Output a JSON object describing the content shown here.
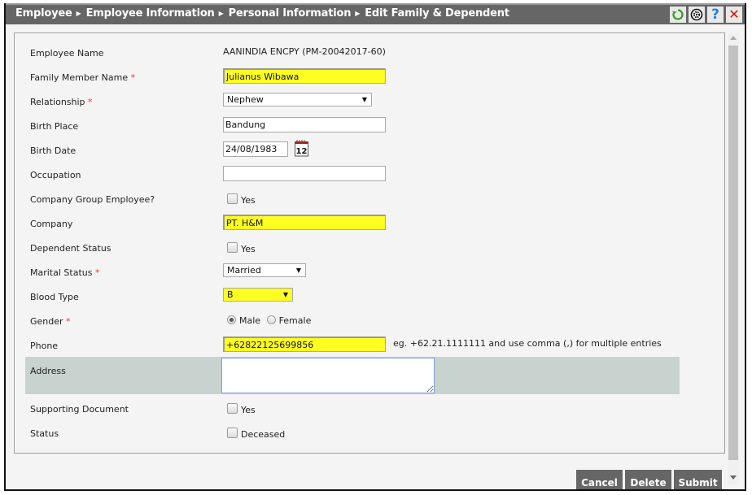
{
  "header": {
    "breadcrumb": [
      "Employee",
      "Employee Information",
      "Personal Information",
      "Edit Family & Dependent"
    ],
    "separator_icon": "triangle-right-icon",
    "icons": [
      "refresh-icon",
      "settings-icon",
      "help-icon",
      "close-icon"
    ],
    "help_glyph": "?",
    "close_glyph": "✕"
  },
  "form": {
    "employee_name": {
      "label": "Employee Name",
      "value": "AANINDIA ENCPY (PM-20042017-60)"
    },
    "family_member_name": {
      "label": "Family Member Name",
      "required": "*",
      "value": "Julianus Wibawa"
    },
    "relationship": {
      "label": "Relationship",
      "required": "*",
      "value": "Nephew"
    },
    "birth_place": {
      "label": "Birth Place",
      "value": "Bandung"
    },
    "birth_date": {
      "label": "Birth Date",
      "value": "24/08/1983",
      "calendar_day": "12"
    },
    "occupation": {
      "label": "Occupation",
      "value": ""
    },
    "company_group_employee": {
      "label": "Company Group Employee?",
      "option": "Yes",
      "checked": false
    },
    "company": {
      "label": "Company",
      "value": "PT. H&M"
    },
    "dependent_status": {
      "label": "Dependent Status",
      "option": "Yes",
      "checked": false
    },
    "marital_status": {
      "label": "Marital Status",
      "required": "*",
      "value": "Married"
    },
    "blood_type": {
      "label": "Blood Type",
      "value": "B"
    },
    "gender": {
      "label": "Gender",
      "required": "*",
      "options": [
        "Male",
        "Female"
      ],
      "selected": "Male"
    },
    "phone": {
      "label": "Phone",
      "value": "+62822125699856",
      "hint": "eg. +62.21.1111111 and use comma (,) for multiple entries"
    },
    "address": {
      "label": "Address",
      "value": ""
    },
    "supporting_document": {
      "label": "Supporting Document",
      "option": "Yes",
      "checked": false
    },
    "status": {
      "label": "Status",
      "option": "Deceased",
      "checked": false
    }
  },
  "actions": {
    "cancel": "Cancel",
    "delete": "Delete",
    "submit": "Submit"
  },
  "colors": {
    "titlebar": "#666666",
    "highlight_field": "#ffff22",
    "required_star": "#ee3333",
    "address_row": "#c8d3d0",
    "button": "#666666"
  }
}
